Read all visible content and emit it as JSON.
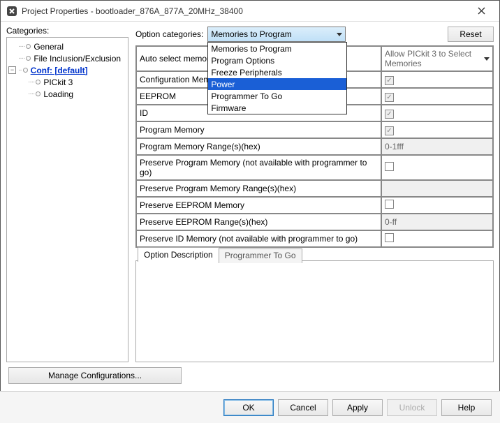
{
  "window": {
    "title": "Project Properties - bootloader_876A_877A_20MHz_38400"
  },
  "categories_label": "Categories:",
  "tree": {
    "general": "General",
    "file_inclusion": "File Inclusion/Exclusion",
    "conf": "Conf: [default]",
    "pickit3": "PICkit 3",
    "loading": "Loading"
  },
  "option_categories_label": "Option categories:",
  "option_categories_value": "Memories to Program",
  "dropdown_items": [
    "Memories to Program",
    "Program Options",
    "Freeze Peripherals",
    "Power",
    "Programmer To Go",
    "Firmware"
  ],
  "dropdown_highlight_index": 3,
  "reset_label": "Reset",
  "rows": [
    {
      "label": "Auto select memories and ranges",
      "value_text": "Allow PICkit 3 to Select Memories",
      "kind": "combo"
    },
    {
      "label": "Configuration Memory",
      "kind": "checkbox_dis_checked"
    },
    {
      "label": "EEPROM",
      "kind": "checkbox_dis_checked"
    },
    {
      "label": "ID",
      "kind": "checkbox_dis_checked"
    },
    {
      "label": "Program Memory",
      "kind": "checkbox_dis_checked"
    },
    {
      "label": "Program Memory Range(s)(hex)",
      "value_text": "0-1fff",
      "kind": "text_dis"
    },
    {
      "label": "Preserve Program Memory (not available with programmer to go)",
      "kind": "checkbox"
    },
    {
      "label": "Preserve Program Memory Range(s)(hex)",
      "kind": "text_dis_empty"
    },
    {
      "label": "Preserve EEPROM Memory",
      "kind": "checkbox"
    },
    {
      "label": "Preserve EEPROM Range(s)(hex)",
      "value_text": "0-ff",
      "kind": "text_dis"
    },
    {
      "label": "Preserve ID Memory (not available with programmer to go)",
      "kind": "checkbox"
    }
  ],
  "tabs": {
    "desc": "Option Description",
    "ptg": "Programmer To Go"
  },
  "manage_label": "Manage Configurations...",
  "buttons": {
    "ok": "OK",
    "cancel": "Cancel",
    "apply": "Apply",
    "unlock": "Unlock",
    "help": "Help"
  }
}
